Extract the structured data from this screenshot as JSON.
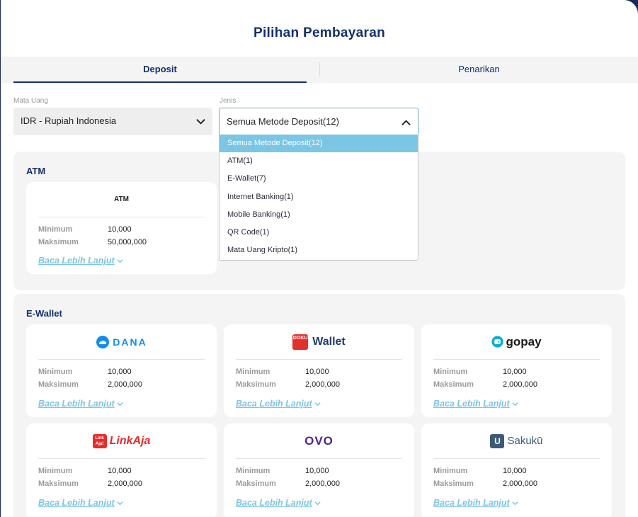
{
  "title": "Pilihan Pembayaran",
  "tabs": {
    "deposit": "Deposit",
    "withdraw": "Penarikan"
  },
  "filters": {
    "currency_label": "Mata Uang",
    "currency_value": "IDR - Rupiah Indonesia",
    "type_label": "Jenis",
    "type_value": "Semua Metode Deposit(12)",
    "type_options": [
      "Semua Metode Deposit(12)",
      "ATM(1)",
      "E-Wallet(7)",
      "Internet Banking(1)",
      "Mobile Banking(1)",
      "QR Code(1)",
      "Mata Uang Kripto(1)"
    ]
  },
  "labels": {
    "min": "Minimum",
    "max": "Maksimum",
    "more": "Baca Lebih Lanjut"
  },
  "sections": {
    "atm": {
      "title": "ATM",
      "cards": [
        {
          "name": "ATM",
          "min": "10,000",
          "max": "50,000,000"
        }
      ]
    },
    "ewallet": {
      "title": "E-Wallet",
      "cards": [
        {
          "name": "DANA",
          "min": "10,000",
          "max": "2,000,000"
        },
        {
          "name": "Wallet",
          "badge": "DOKU",
          "min": "10,000",
          "max": "2,000,000"
        },
        {
          "name": "gopay",
          "min": "10,000",
          "max": "2,000,000"
        },
        {
          "name": "LinkAja",
          "badge": "Link Aja!",
          "min": "10,000",
          "max": "2,000,000"
        },
        {
          "name": "OVO",
          "min": "10,000",
          "max": "2,000,000"
        },
        {
          "name": "Sakukū",
          "badge": "U",
          "min": "10,000",
          "max": "2,000,000"
        }
      ]
    }
  },
  "colors": {
    "primary": "#13306d",
    "accent": "#7bc5e5",
    "panel": "#f4f4f4",
    "linkaja": "#e82a2a",
    "doku": "#e0312a",
    "gopay": "#00aed6",
    "dana": "#118ee9",
    "ovo": "#4c2a86"
  }
}
